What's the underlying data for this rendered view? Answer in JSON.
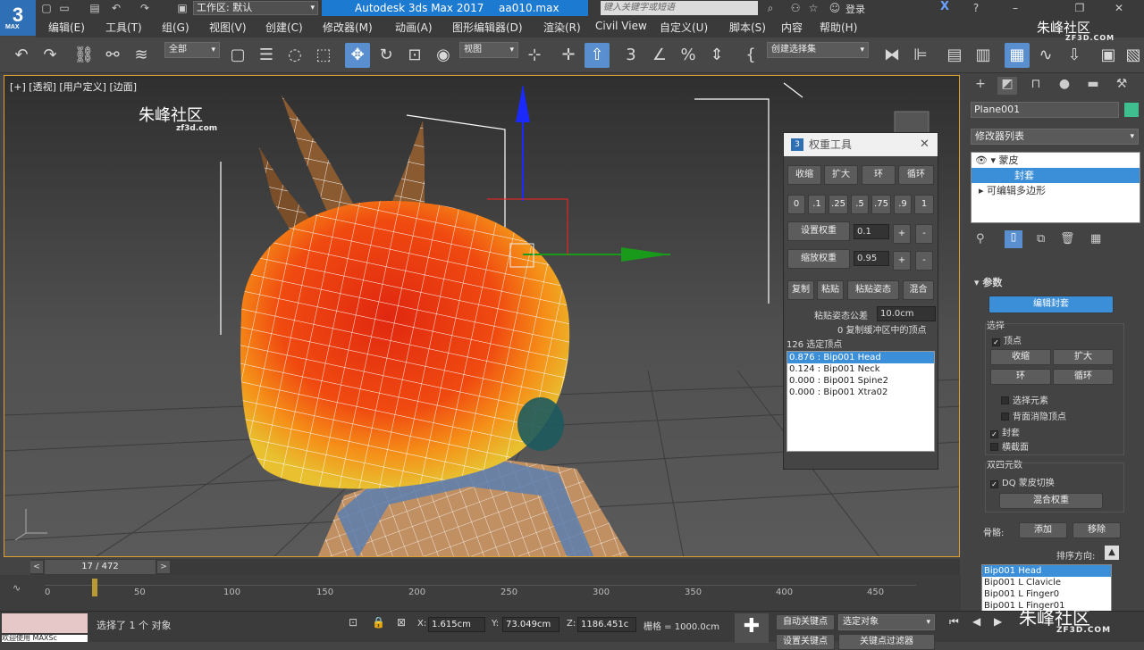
{
  "app": {
    "logo": "3",
    "logo_sub": "MAX",
    "workspace_label": "工作区: 默认",
    "title": "Autodesk 3ds Max 2017",
    "file": "aa010.max",
    "search_placeholder": "键入关键字或短语",
    "login": "登录"
  },
  "menu": [
    "编辑(E)",
    "工具(T)",
    "组(G)",
    "视图(V)",
    "创建(C)",
    "修改器(M)",
    "动画(A)",
    "图形编辑器(D)",
    "渲染(R)",
    "Civil View",
    "自定义(U)",
    "脚本(S)",
    "内容",
    "帮助(H)"
  ],
  "toolbar": {
    "filter": "全部",
    "ref_coord": "视图",
    "selection_set": "创建选择集"
  },
  "viewport": {
    "label": "[+] [透视] [用户定义] [边面]",
    "watermark": "朱峰社区",
    "watermark_sub": "zf3d.com"
  },
  "weight_tool": {
    "title": "权重工具",
    "shrink": "收缩",
    "grow": "扩大",
    "ring": "环",
    "loop": "循环",
    "presets": [
      "0",
      ".1",
      ".25",
      ".5",
      ".75",
      ".9",
      "1"
    ],
    "set_weight": "设置权重",
    "set_weight_value": "0.1",
    "scale_weight": "缩放权重",
    "scale_weight_value": "0.95",
    "plus": "+",
    "minus": "-",
    "copy": "复制",
    "paste": "粘贴",
    "paste_pos": "粘贴姿态",
    "blend": "混合",
    "paste_tol_label": "粘贴姿态公差",
    "paste_tol_value": "10.0cm",
    "copy_buffer": "0 复制缓冲区中的顶点",
    "selected_count": "126 选定顶点",
    "weights": [
      "0.876 : Bip001 Head",
      "0.124 : Bip001 Neck",
      "0.000 : Bip001 Spine2",
      "0.000 : Bip001 Xtra02"
    ]
  },
  "command_panel": {
    "object_name": "Plane001",
    "modifier_list": "修改器列表",
    "stack": [
      "蒙皮",
      "封套",
      "可编辑多边形"
    ],
    "params_title": "参数",
    "edit_envelopes": "编辑封套",
    "select_title": "选择",
    "vertices": "顶点",
    "shrink": "收缩",
    "grow": "扩大",
    "ring": "环",
    "loop": "循环",
    "select_element": "选择元素",
    "backface_cull": "背面消隐顶点",
    "envelopes": "封套",
    "cross_sections": "横截面",
    "dq_title": "双四元数",
    "dq_toggle": "DQ 蒙皮切换",
    "blend_weights": "混合权重",
    "bones_label": "骨骼:",
    "add": "添加",
    "remove": "移除",
    "sort_label": "排序方向:",
    "bones": [
      "Bip001 Head",
      "Bip001 L Clavicle",
      "Bip001 L Finger0",
      "Bip001 L Finger01"
    ]
  },
  "timeline": {
    "frame": "17 / 472",
    "current_frame": 17,
    "total_frames": 472,
    "ticks": [
      "0",
      "50",
      "100",
      "150",
      "200",
      "250",
      "300",
      "350",
      "400",
      "450"
    ]
  },
  "status": {
    "maxscript": "欢迎使用 MAXSc",
    "selected": "选择了 1 个 对象",
    "x_label": "X:",
    "x": "1.615cm",
    "y_label": "Y:",
    "y": "73.049cm",
    "z_label": "Z:",
    "z": "1186.451c",
    "grid": "栅格 = 1000.0cm",
    "autokey": "自动关键点",
    "selected_obj": "选定对象",
    "setkey": "设置关键点",
    "keyfilter": "关键点过滤器"
  },
  "watermark": {
    "main": "朱峰社区",
    "sub": "ZF3D.COM"
  },
  "colors": {
    "accent": "#3b8ed8",
    "title_blue": "#1d7ad1",
    "viewport_border": "#e0a030"
  }
}
